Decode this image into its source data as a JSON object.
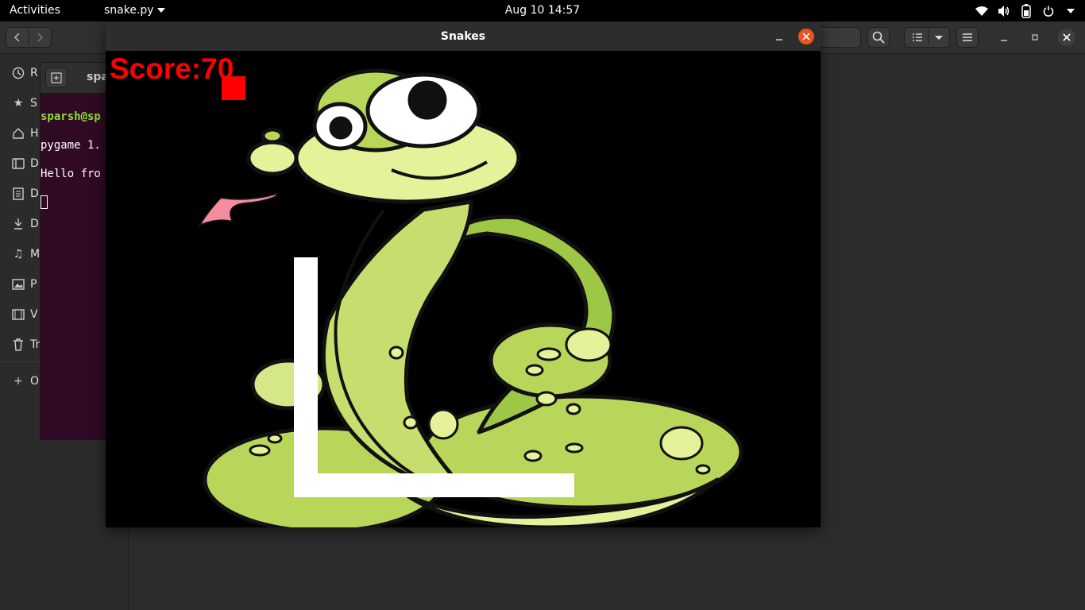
{
  "topbar": {
    "activities": "Activities",
    "app_menu": "snake.py",
    "clock": "Aug 10  14:57"
  },
  "files": {
    "sidebar": {
      "items": [
        {
          "label": "R",
          "icon": "recent-icon"
        },
        {
          "label": "S",
          "icon": "star-icon"
        },
        {
          "label": "H",
          "icon": "home-icon"
        },
        {
          "label": "D",
          "icon": "desktop-icon"
        },
        {
          "label": "D",
          "icon": "documents-icon"
        },
        {
          "label": "D",
          "icon": "downloads-icon"
        },
        {
          "label": "M",
          "icon": "music-icon"
        },
        {
          "label": "P",
          "icon": "pictures-icon"
        },
        {
          "label": "V",
          "icon": "videos-icon"
        },
        {
          "label": "Tr",
          "icon": "trash-icon"
        },
        {
          "label": "O",
          "icon": "plus-icon"
        }
      ]
    }
  },
  "terminal": {
    "title": "spa",
    "lines": {
      "prompt": "sparsh@sp",
      "line2": "pygame 1.",
      "line3": "Hello fro"
    }
  },
  "game": {
    "title": "Snakes",
    "score": "Score:70",
    "colors": {
      "background": "#000000",
      "score": "#ff0000",
      "food": "#ff0000",
      "snake": "#ffffff",
      "close_button": "#e95420"
    }
  }
}
